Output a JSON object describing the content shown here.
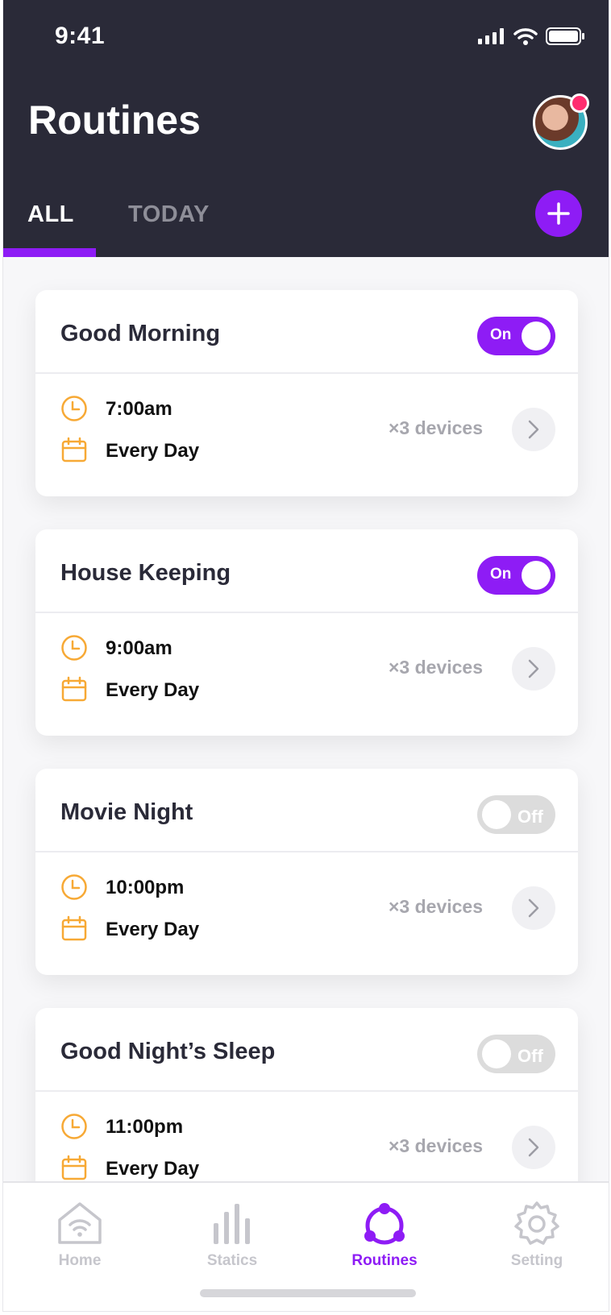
{
  "status_bar": {
    "time": "9:41"
  },
  "header": {
    "title": "Routines",
    "tabs": [
      {
        "label": "ALL",
        "active": true
      },
      {
        "label": "TODAY",
        "active": false
      }
    ]
  },
  "colors": {
    "accent": "#8e1cf5",
    "header_bg": "#2a2a38",
    "icon_orange": "#f7a935",
    "notification": "#ff2d6f"
  },
  "routines": [
    {
      "title": "Good Morning",
      "toggle": "On",
      "enabled": true,
      "time": "7:00am",
      "repeat": "Every Day",
      "devices": "×3 devices"
    },
    {
      "title": "House Keeping",
      "toggle": "On",
      "enabled": true,
      "time": "9:00am",
      "repeat": "Every Day",
      "devices": "×3 devices"
    },
    {
      "title": "Movie Night",
      "toggle": "Off",
      "enabled": false,
      "time": "10:00pm",
      "repeat": "Every Day",
      "devices": "×3 devices"
    },
    {
      "title": "Good Night’s Sleep",
      "toggle": "Off",
      "enabled": false,
      "time": "11:00pm",
      "repeat": "Every Day",
      "devices": "×3 devices"
    }
  ],
  "icons": {
    "time": "clock-icon",
    "repeat": "calendar-icon",
    "open": "chevron-right-icon",
    "add": "plus-icon"
  },
  "bottom_nav": [
    {
      "label": "Home",
      "icon": "home-wifi-icon",
      "active": false
    },
    {
      "label": "Statics",
      "icon": "bar-chart-icon",
      "active": false
    },
    {
      "label": "Routines",
      "icon": "routines-icon",
      "active": true
    },
    {
      "label": "Setting",
      "icon": "gear-icon",
      "active": false
    }
  ]
}
